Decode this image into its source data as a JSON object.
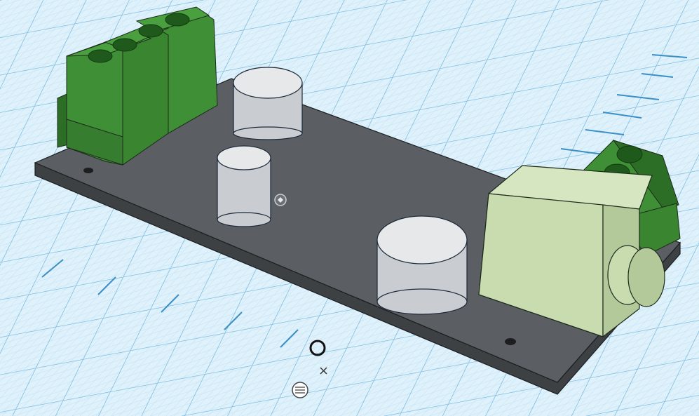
{
  "workplane": {
    "background_color": "#dff1fb",
    "minor_grid_color": "#b6dcf0",
    "major_grid_color": "#5aa9d6"
  },
  "scene": {
    "board": {
      "top_color": "#5b5e62",
      "side_color": "#3e4144",
      "edge_color": "#1c1e20"
    },
    "terminal_blocks": {
      "color": "#3e8f35",
      "dark_color": "#2d6e27",
      "hole_color": "#1f5a1c"
    },
    "capacitors": {
      "top_color": "#e6e8ea",
      "side_color": "#c9ccd0",
      "outline_color": "#1c2a3a"
    },
    "audio_jack": {
      "color": "#c8dcb0",
      "side_color": "#a8bd8f"
    }
  },
  "view_controls": {
    "origin_icon": "circle-marker-icon",
    "crosshair_icon": "plus-crosshair-icon",
    "snap_icon": "snap-grid-icon"
  }
}
